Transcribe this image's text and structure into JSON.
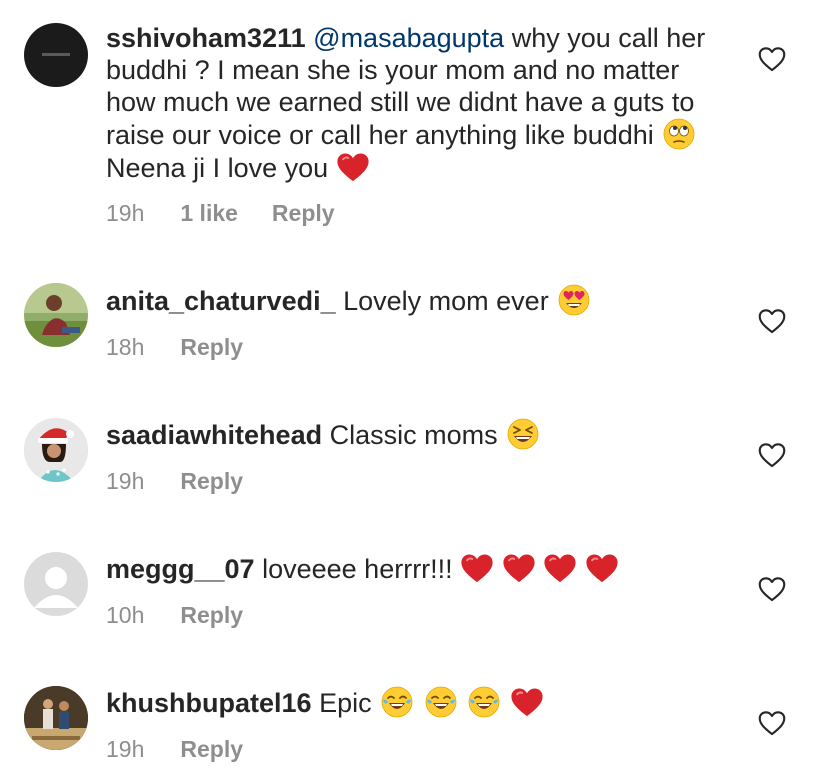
{
  "comments": [
    {
      "username": "sshivoham3211",
      "mention": "@masabagupta",
      "text_a": "why you call her buddhi ? I mean she is your mom and no matter how much we earned still we didnt have a guts to raise our voice or call her anything like buddhi",
      "text_b": "Neena ji I love you",
      "time": "19h",
      "likes": "1 like",
      "reply": "Reply"
    },
    {
      "username": "anita_chaturvedi_",
      "text": "Lovely mom ever",
      "time": "18h",
      "reply": "Reply"
    },
    {
      "username": "saadiawhitehead",
      "text": "Classic moms",
      "time": "19h",
      "reply": "Reply"
    },
    {
      "username": "meggg__07",
      "text": "loveeee herrrr!!!",
      "time": "10h",
      "reply": "Reply"
    },
    {
      "username": "khushbupatel16",
      "text": "Epic",
      "time": "19h",
      "reply": "Reply"
    }
  ],
  "icons": {
    "like": "heart-outline-icon",
    "emoji_eyeroll": "face-rolling-eyes-emoji",
    "emoji_hearteyes": "heart-eyes-emoji",
    "emoji_laugh": "grinning-squinting-emoji",
    "emoji_tears": "tears-of-joy-emoji",
    "emoji_heart": "red-heart-emoji"
  },
  "colors": {
    "text": "#262626",
    "secondary": "#8e8e8e",
    "mention": "#00376b",
    "heart": "#e0245e"
  }
}
